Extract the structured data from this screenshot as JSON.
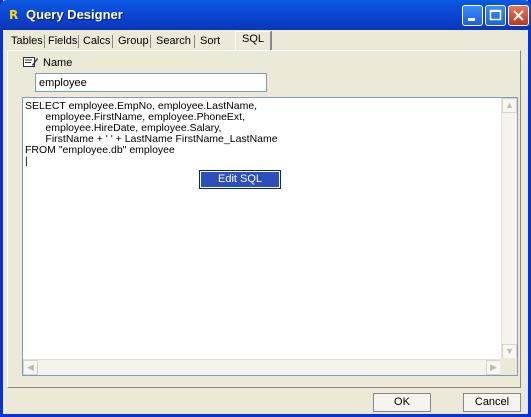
{
  "window": {
    "title": "Query Designer",
    "app_icon": "R"
  },
  "tabs": [
    {
      "label": "Tables"
    },
    {
      "label": "Fields"
    },
    {
      "label": "Calcs"
    },
    {
      "label": "Group"
    },
    {
      "label": "Search"
    },
    {
      "label": "Sort"
    },
    {
      "label": "SQL",
      "active": true
    }
  ],
  "name_field": {
    "label": "Name",
    "value": "employee",
    "icon": "name-edit-icon"
  },
  "sql": {
    "text": "SELECT employee.EmpNo, employee.LastName,\n       employee.FirstName, employee.PhoneExt,\n       employee.HireDate, employee.Salary,\n       FirstName + ' ' + LastName FirstName_LastName\nFROM \"employee.db\" employee\n|",
    "edit_button": "Edit SQL"
  },
  "buttons": {
    "ok": "OK",
    "cancel": "Cancel"
  },
  "colors": {
    "titlebar": "#0a4bd8",
    "button_face": "#ece9d8",
    "selected": "#2c4fbe"
  }
}
